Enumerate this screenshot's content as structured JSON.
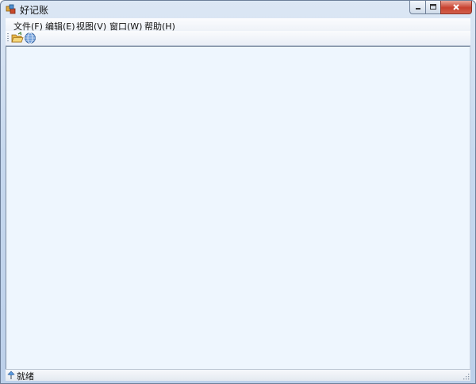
{
  "window": {
    "title": "好记账"
  },
  "menu": {
    "items": [
      {
        "label": "文件(F)"
      },
      {
        "label": "编辑(E)"
      },
      {
        "label": "视图(V)"
      },
      {
        "label": "窗口(W)"
      },
      {
        "label": "帮助(H)"
      }
    ]
  },
  "toolbar": {
    "icons": [
      "open-folder-icon",
      "globe-icon"
    ]
  },
  "statusbar": {
    "text": "就绪"
  },
  "colors": {
    "content_bg": "#eef6fe",
    "close_button": "#c8412e",
    "chrome": "#c6d8ee"
  }
}
